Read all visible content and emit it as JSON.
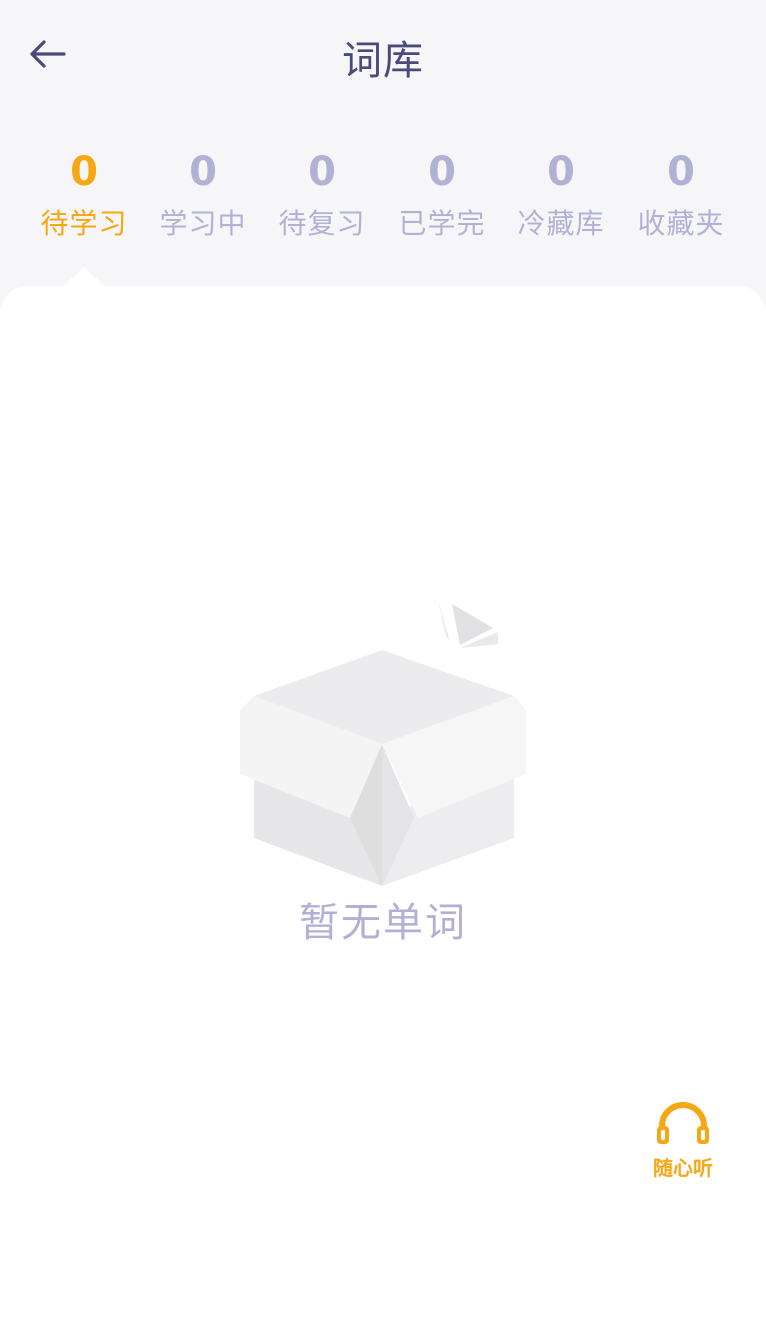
{
  "header": {
    "title": "词库"
  },
  "tabs": [
    {
      "count": "0",
      "label": "待学习",
      "active": true
    },
    {
      "count": "0",
      "label": "学习中"
    },
    {
      "count": "0",
      "label": "待复习"
    },
    {
      "count": "0",
      "label": "已学完"
    },
    {
      "count": "0",
      "label": "冷藏库"
    },
    {
      "count": "0",
      "label": "收藏夹"
    }
  ],
  "empty_state": {
    "message": "暂无单词",
    "icon": "empty-box-icon"
  },
  "listen": {
    "label": "随心听",
    "icon": "headphones-icon"
  },
  "colors": {
    "accent": "#f7a614",
    "inactive": "#b1b1d6",
    "title": "#4a4a7c"
  }
}
